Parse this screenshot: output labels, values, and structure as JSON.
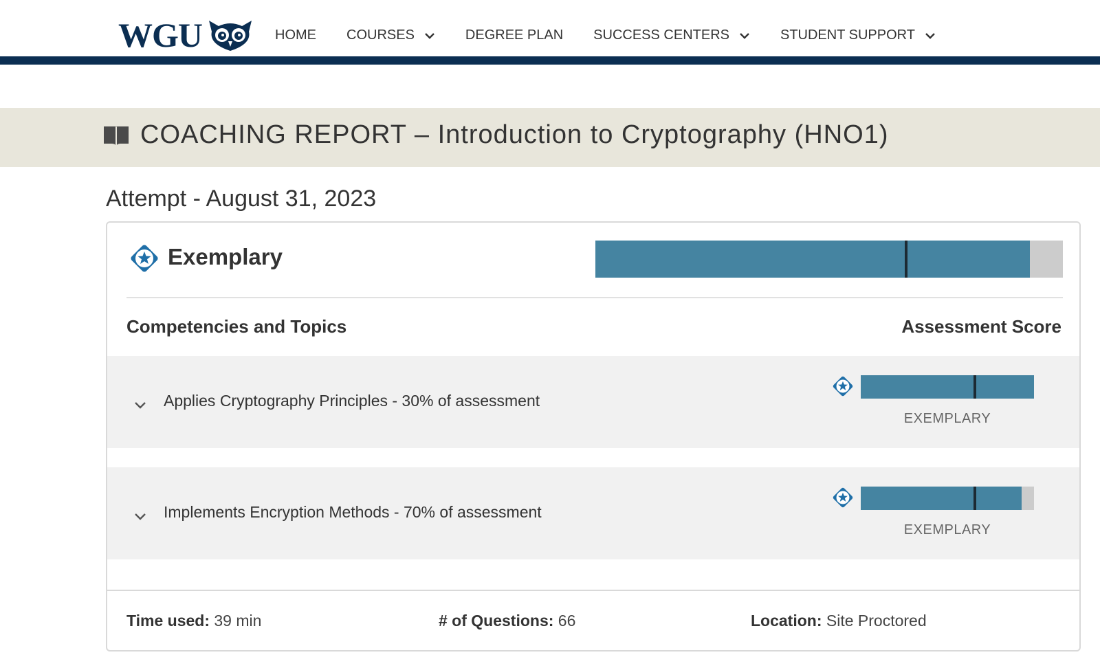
{
  "header": {
    "logo_text": "WGU",
    "nav": [
      {
        "label": "HOME",
        "dropdown": false
      },
      {
        "label": "COURSES",
        "dropdown": true
      },
      {
        "label": "DEGREE PLAN",
        "dropdown": false
      },
      {
        "label": "SUCCESS CENTERS",
        "dropdown": true
      },
      {
        "label": "STUDENT SUPPORT",
        "dropdown": true
      }
    ]
  },
  "banner": {
    "icon": "book-icon",
    "title": "COACHING REPORT – Introduction to Cryptography (HNO1)"
  },
  "attempt": "Attempt - August 31, 2023",
  "report": {
    "overall_level": "Exemplary",
    "overall_score_fraction": 0.93,
    "overall_marker_fraction": 0.665,
    "columns": {
      "left": "Competencies and Topics",
      "right": "Assessment Score"
    },
    "competencies": [
      {
        "label": "Applies Cryptography Principles - 30% of assessment",
        "level": "EXEMPLARY",
        "score_fraction": 1.0,
        "marker_fraction": 0.66
      },
      {
        "label": "Implements Encryption Methods - 70% of assessment",
        "level": "EXEMPLARY",
        "score_fraction": 0.93,
        "marker_fraction": 0.66
      }
    ],
    "footer": {
      "time_used_label": "Time used:",
      "time_used_value": "39 min",
      "questions_label": "# of Questions:",
      "questions_value": "66",
      "location_label": "Location:",
      "location_value": "Site Proctored"
    }
  },
  "colors": {
    "nav_bar": "#0b2e52",
    "score_fill": "#4584a1",
    "score_track": "#cccccc",
    "badge": "#1f6fa8",
    "banner_bg": "#e8e6db",
    "row_bg": "#f1f1f1"
  }
}
